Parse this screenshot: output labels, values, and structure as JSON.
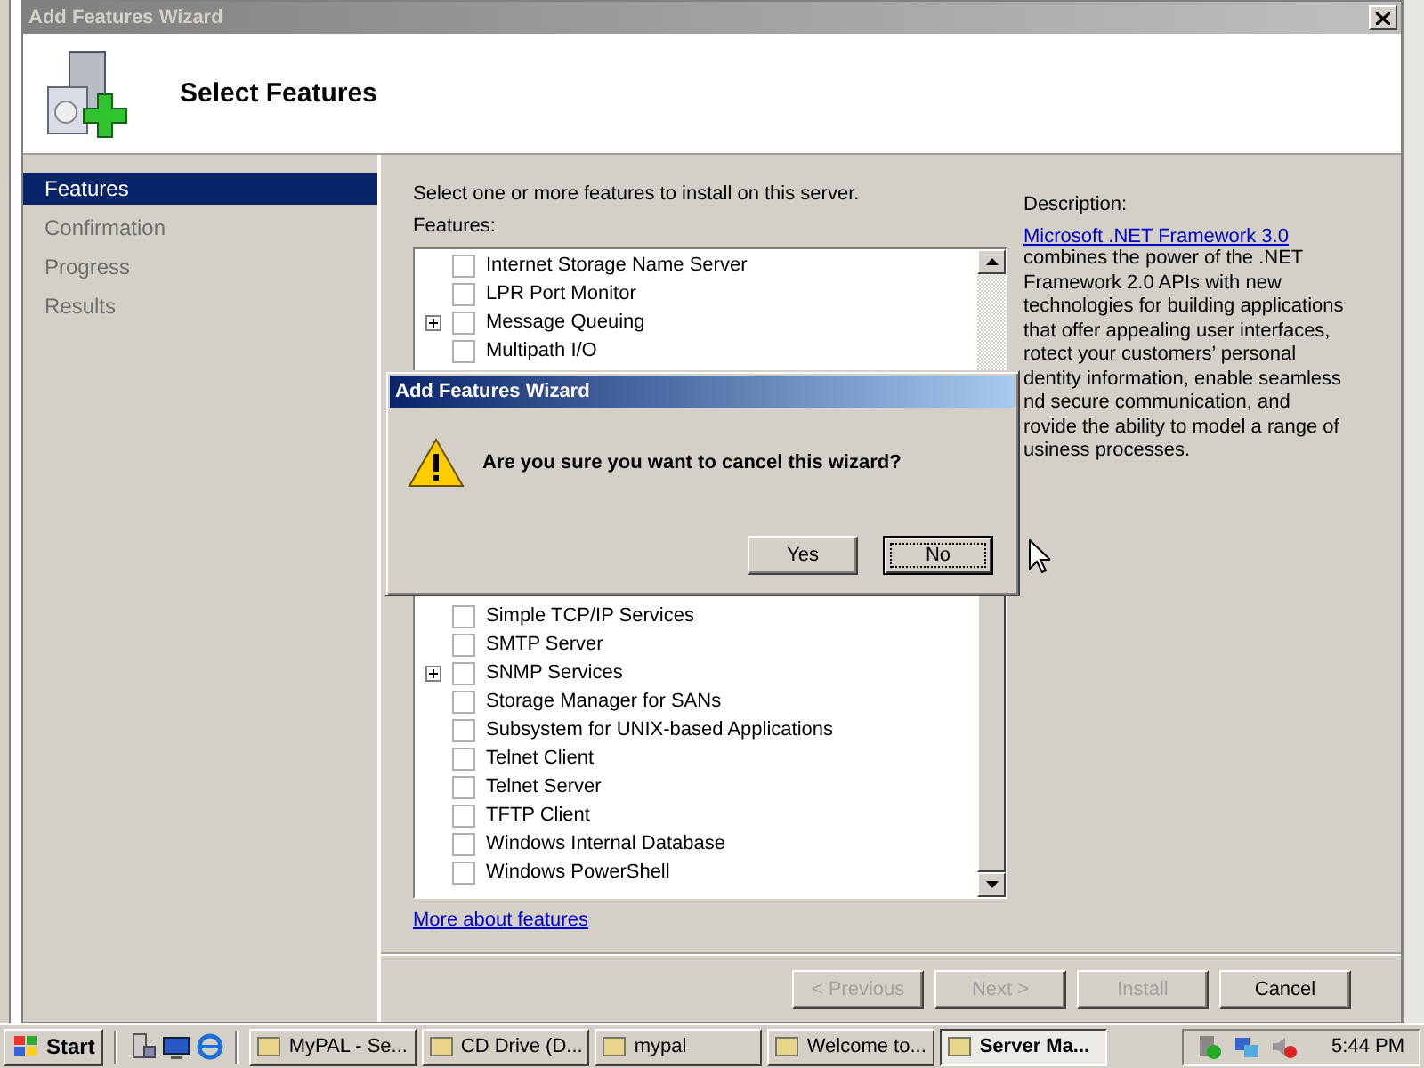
{
  "window": {
    "title": "Add Features Wizard",
    "heading": "Select Features"
  },
  "nav": [
    {
      "label": "Features",
      "selected": true
    },
    {
      "label": "Confirmation",
      "selected": false
    },
    {
      "label": "Progress",
      "selected": false
    },
    {
      "label": "Results",
      "selected": false
    }
  ],
  "intro": "Select one or more features to install on this server.",
  "features_label": "Features:",
  "features_top": [
    {
      "label": "Internet Storage Name Server",
      "checked": false,
      "has_children": false
    },
    {
      "label": "LPR Port Monitor",
      "checked": false,
      "has_children": false
    },
    {
      "label": "Message Queuing",
      "checked": false,
      "has_children": true
    },
    {
      "label": "Multipath I/O",
      "checked": false,
      "has_children": false
    }
  ],
  "features_bottom": [
    {
      "label": "Simple TCP/IP Services",
      "checked": false,
      "has_children": false
    },
    {
      "label": "SMTP Server",
      "checked": false,
      "has_children": false
    },
    {
      "label": "SNMP Services",
      "checked": false,
      "has_children": true
    },
    {
      "label": "Storage Manager for SANs",
      "checked": false,
      "has_children": false
    },
    {
      "label": "Subsystem for UNIX-based Applications",
      "checked": false,
      "has_children": false
    },
    {
      "label": "Telnet Client",
      "checked": false,
      "has_children": false
    },
    {
      "label": "Telnet Server",
      "checked": false,
      "has_children": false
    },
    {
      "label": "TFTP Client",
      "checked": false,
      "has_children": false
    },
    {
      "label": "Windows Internal Database",
      "checked": false,
      "has_children": false
    },
    {
      "label": "Windows PowerShell",
      "checked": false,
      "has_children": false
    }
  ],
  "more_link": "More about features",
  "description": {
    "label": "Description:",
    "link": "Microsoft .NET Framework 3.0",
    "lines": [
      "combines the power of the .NET",
      "Framework 2.0 APIs with new",
      "technologies for building applications",
      "that offer appealing user interfaces,",
      "rotect your customers’ personal",
      "dentity information, enable seamless",
      "nd secure communication, and",
      "rovide the ability to model a range of",
      "usiness processes."
    ]
  },
  "buttons": [
    {
      "label": "< Previous",
      "disabled": true
    },
    {
      "label": "Next >",
      "disabled": true
    },
    {
      "label": "Install",
      "disabled": true
    },
    {
      "label": "Cancel",
      "disabled": false
    }
  ],
  "dialog": {
    "title": "Add Features Wizard",
    "message": "Are you sure you want to cancel this wizard?",
    "buttons": [
      {
        "label": "Yes",
        "focused": false
      },
      {
        "label": "No",
        "focused": true
      }
    ]
  },
  "taskbar": {
    "start": "Start",
    "tasks": [
      {
        "label": "MyPAL - Se...",
        "selected": false
      },
      {
        "label": "CD Drive (D...",
        "selected": false
      },
      {
        "label": "mypal",
        "selected": false
      },
      {
        "label": "Welcome to...",
        "selected": false
      },
      {
        "label": "Server Ma...",
        "selected": true
      }
    ],
    "clock": "5:44 PM"
  }
}
